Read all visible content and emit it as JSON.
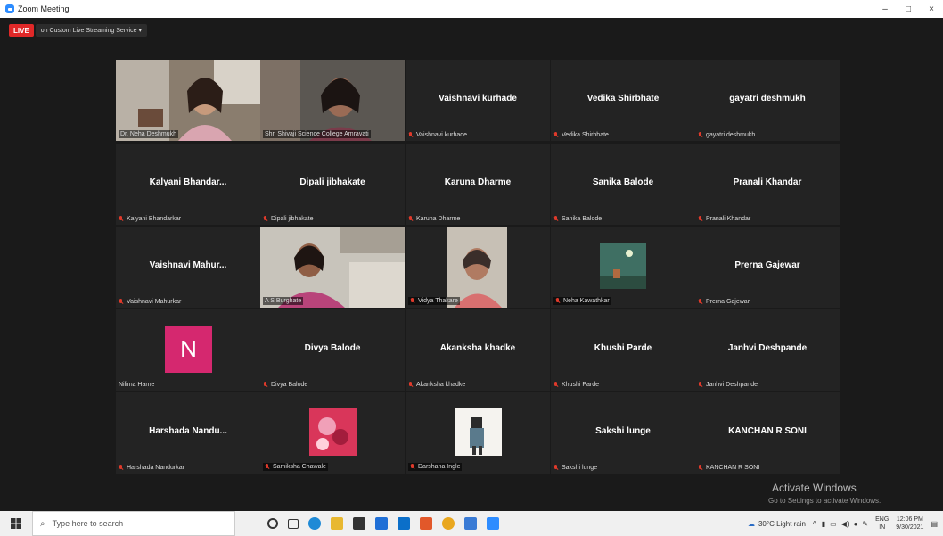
{
  "window": {
    "title": "Zoom Meeting",
    "controls": [
      "–",
      "□",
      "×"
    ]
  },
  "live": {
    "badge": "LIVE",
    "text": "on Custom Live Streaming Service"
  },
  "tiles": [
    {
      "display": "",
      "label": "Dr. Neha Deshmukh",
      "muted": false,
      "video": "cam1",
      "speaker": true
    },
    {
      "display": "",
      "label": "Shri Shivaji Science College Amravati",
      "muted": false,
      "video": "cam2"
    },
    {
      "display": "Vaishnavi kurhade",
      "label": "Vaishnavi kurhade",
      "muted": true
    },
    {
      "display": "Vedika Shirbhate",
      "label": "Vedika Shirbhate",
      "muted": true
    },
    {
      "display": "gayatri deshmukh",
      "label": "gayatri deshmukh",
      "muted": true
    },
    {
      "display": "Kalyani  Bhandar...",
      "label": "Kalyani Bhandarkar",
      "muted": true
    },
    {
      "display": "Dipali jibhakate",
      "label": "Dipali jibhakate",
      "muted": true
    },
    {
      "display": "Karuna Dharme",
      "label": "Karuna Dharme",
      "muted": true
    },
    {
      "display": "Sanika Balode",
      "label": "Sanika Balode",
      "muted": true
    },
    {
      "display": "Pranali Khandar",
      "label": "Pranali Khandar",
      "muted": true
    },
    {
      "display": "Vaishnavi  Mahur...",
      "label": "Vaishnavi Mahurkar",
      "muted": true
    },
    {
      "display": "",
      "label": "A S Burghate",
      "muted": false,
      "video": "cam3"
    },
    {
      "display": "",
      "label": "Vidya Thakare",
      "muted": true,
      "video": "cam4"
    },
    {
      "display": "",
      "label": "Neha Kawathkar",
      "muted": true,
      "video": "pic1"
    },
    {
      "display": "Prerna Gajewar",
      "label": "Prerna Gajewar",
      "muted": true
    },
    {
      "display": "",
      "label": "Nilima Harne",
      "muted": false,
      "avatar": "N"
    },
    {
      "display": "Divya Balode",
      "label": "Divya Balode",
      "muted": true
    },
    {
      "display": "Akanksha khadke",
      "label": "Akanksha khadke",
      "muted": true
    },
    {
      "display": "Khushi Parde",
      "label": "Khushi Parde",
      "muted": true
    },
    {
      "display": "Janhvi  Deshpande",
      "label": "Janhvi  Deshpande",
      "muted": true
    },
    {
      "display": "Harshada  Nandu...",
      "label": "Harshada Nandurkar",
      "muted": true
    },
    {
      "display": "",
      "label": "Samiksha Chawale",
      "muted": true,
      "video": "pic2"
    },
    {
      "display": "",
      "label": "Darshana Ingle",
      "muted": true,
      "video": "pic3"
    },
    {
      "display": "Sakshi lunge",
      "label": "Sakshi lunge",
      "muted": true
    },
    {
      "display": "KANCHAN R SONI",
      "label": "KANCHAN R SONI",
      "muted": true
    }
  ],
  "watermark": {
    "title": "Activate Windows",
    "sub": "Go to Settings to activate Windows."
  },
  "taskbar": {
    "search_placeholder": "Type here to search",
    "weather": "30°C  Light rain",
    "lang1": "ENG",
    "lang2": "IN",
    "time": "12:06 PM",
    "date": "9/30/2021"
  },
  "colors": {
    "accent": "#2d8cff",
    "live": "#e02828",
    "speaker_border": "#c8e25a",
    "avatar_bg": "#d5286f",
    "mic_muted": "#e03a2b"
  }
}
